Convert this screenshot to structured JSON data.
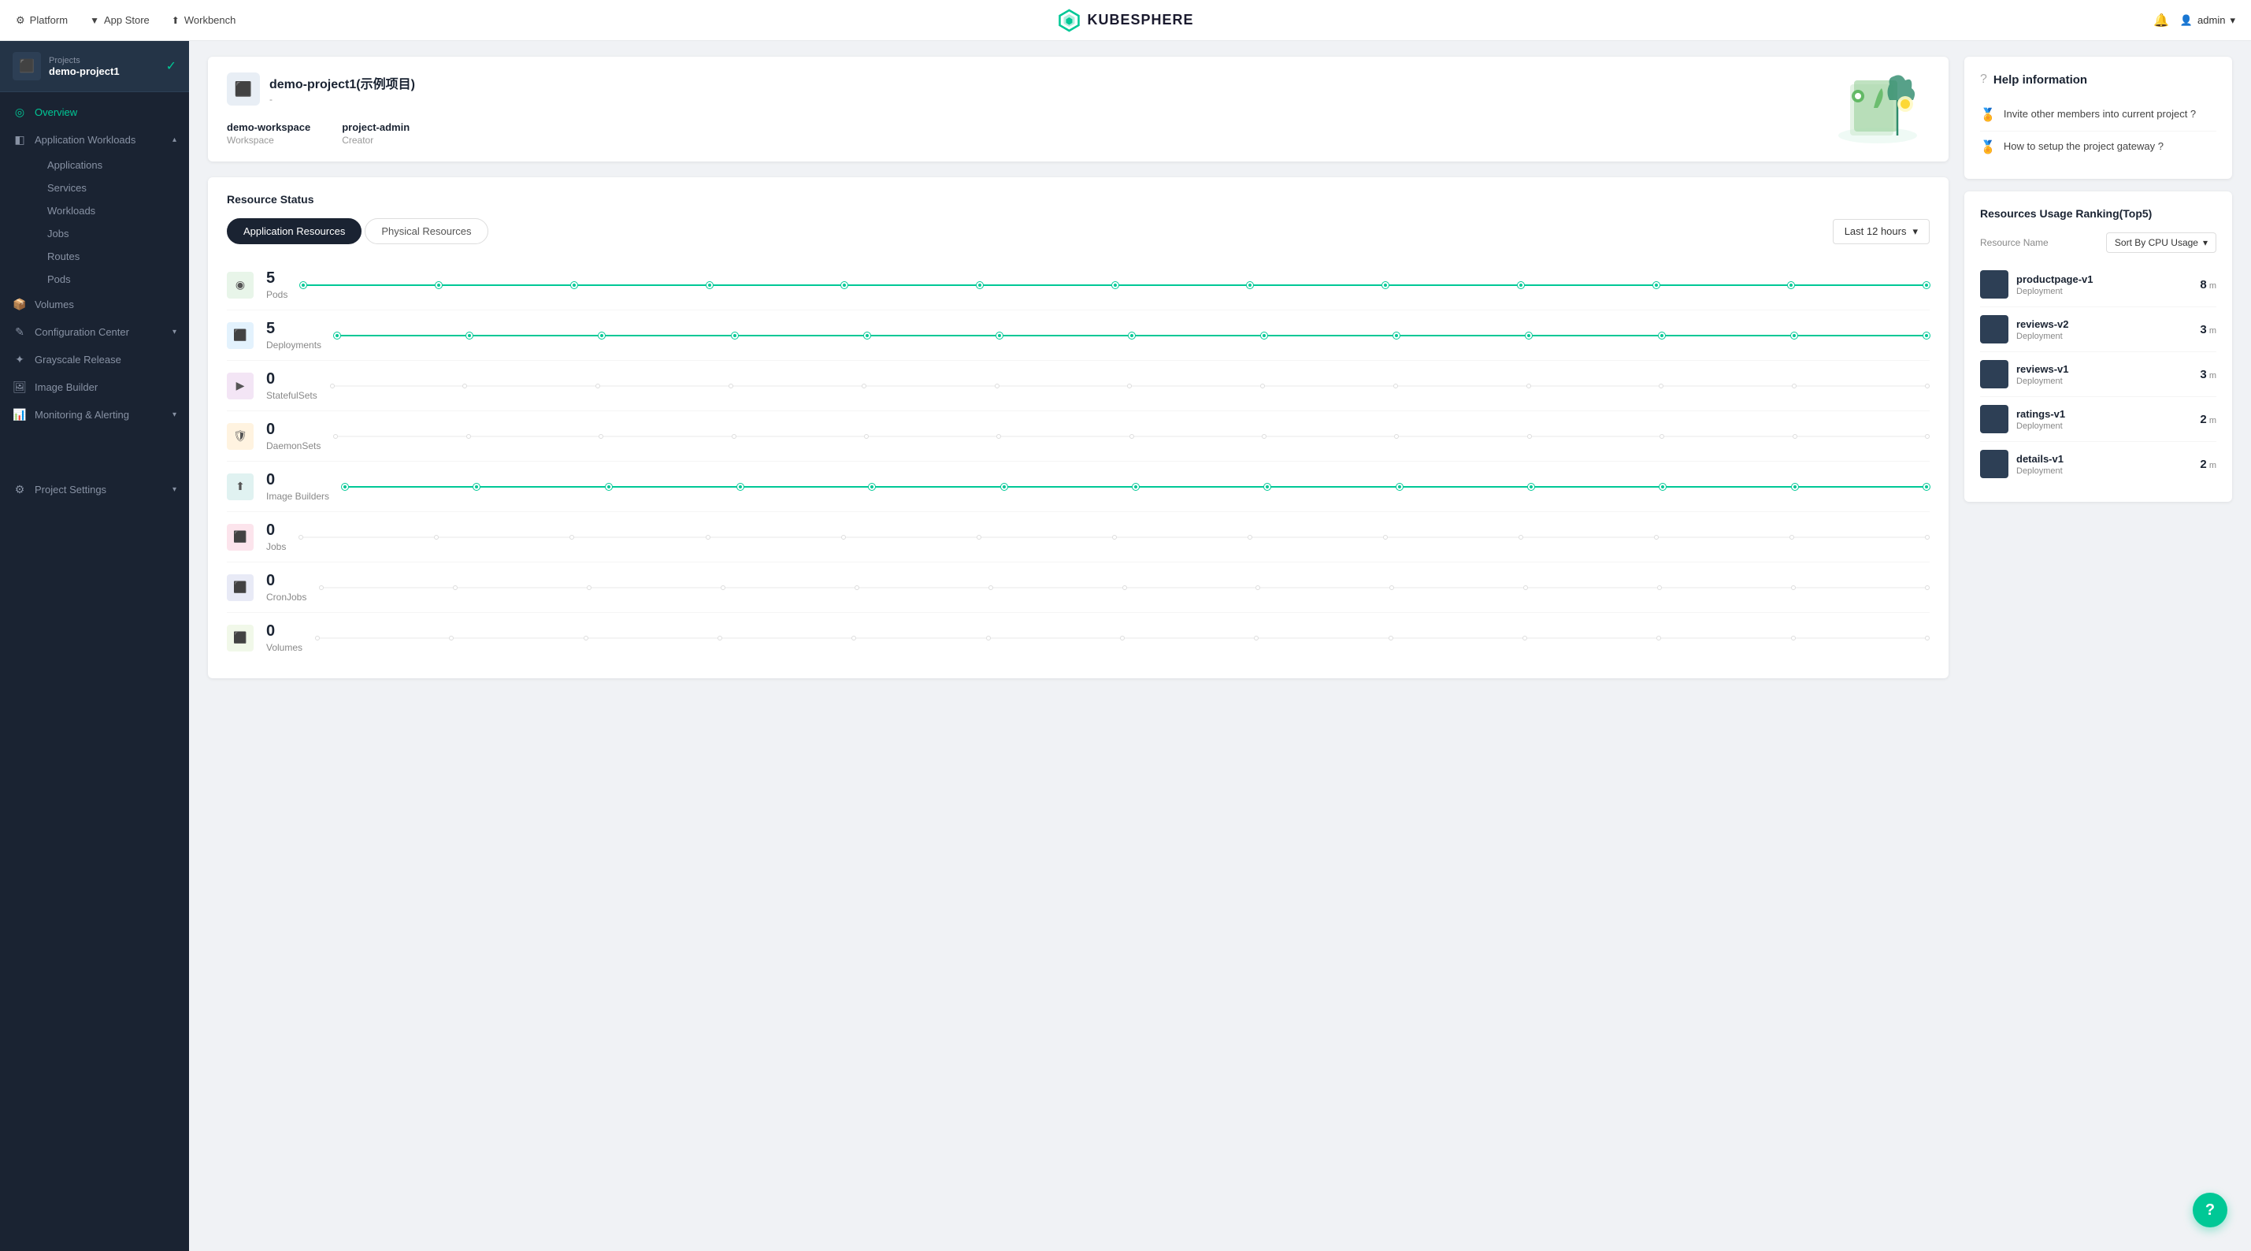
{
  "topnav": {
    "platform_label": "Platform",
    "appstore_label": "App Store",
    "workbench_label": "Workbench",
    "logo_text": "KUBESPHERE",
    "admin_label": "admin"
  },
  "sidebar": {
    "project_label": "Projects",
    "project_name": "demo-project1",
    "nav": {
      "overview": "Overview",
      "app_workloads": "Application Workloads",
      "applications": "Applications",
      "services": "Services",
      "workloads": "Workloads",
      "jobs": "Jobs",
      "routes": "Routes",
      "pods": "Pods",
      "volumes": "Volumes",
      "config_center": "Configuration Center",
      "grayscale": "Grayscale Release",
      "image_builder": "Image Builder",
      "monitoring": "Monitoring & Alerting",
      "project_settings": "Project Settings"
    }
  },
  "main": {
    "title": "Overview",
    "project_card": {
      "name": "demo-project1(示例项目)",
      "sub": "-",
      "workspace_label": "Workspace",
      "workspace_value": "demo-workspace",
      "creator_label": "Creator",
      "creator_value": "project-admin"
    },
    "resource_status": {
      "title": "Resource Status",
      "tab_app": "Application Resources",
      "tab_physical": "Physical Resources",
      "time_range": "Last 12 hours",
      "resources": [
        {
          "icon": "◉",
          "count": "5",
          "name": "Pods",
          "has_chart": true
        },
        {
          "icon": "⬛",
          "count": "5",
          "name": "Deployments",
          "has_chart": true
        },
        {
          "icon": "▶",
          "count": "0",
          "name": "StatefulSets",
          "has_chart": false
        },
        {
          "icon": "🛡",
          "count": "0",
          "name": "DaemonSets",
          "has_chart": false
        },
        {
          "icon": "⬆",
          "count": "0",
          "name": "Image Builders",
          "has_chart": true
        },
        {
          "icon": "⬛",
          "count": "0",
          "name": "Jobs",
          "has_chart": false
        },
        {
          "icon": "⬛",
          "count": "0",
          "name": "CronJobs",
          "has_chart": false
        },
        {
          "icon": "⬛",
          "count": "0",
          "name": "Volumes",
          "has_chart": false
        }
      ]
    },
    "help": {
      "title": "Help information",
      "items": [
        {
          "icon": "🏅",
          "text": "Invite other members into current project ?"
        },
        {
          "icon": "🏅",
          "text": "How to setup the project gateway ?"
        }
      ]
    },
    "rankings": {
      "title": "Resources Usage Ranking(Top5)",
      "sort_label": "Sort By CPU Usage",
      "column_name": "Resource Name",
      "items": [
        {
          "name": "productpage-v1",
          "type": "Deployment",
          "value": "8",
          "unit": "m"
        },
        {
          "name": "reviews-v2",
          "type": "Deployment",
          "value": "3",
          "unit": "m"
        },
        {
          "name": "reviews-v1",
          "type": "Deployment",
          "value": "3",
          "unit": "m"
        },
        {
          "name": "ratings-v1",
          "type": "Deployment",
          "value": "2",
          "unit": "m"
        },
        {
          "name": "details-v1",
          "type": "Deployment",
          "value": "2",
          "unit": "m"
        }
      ]
    }
  }
}
